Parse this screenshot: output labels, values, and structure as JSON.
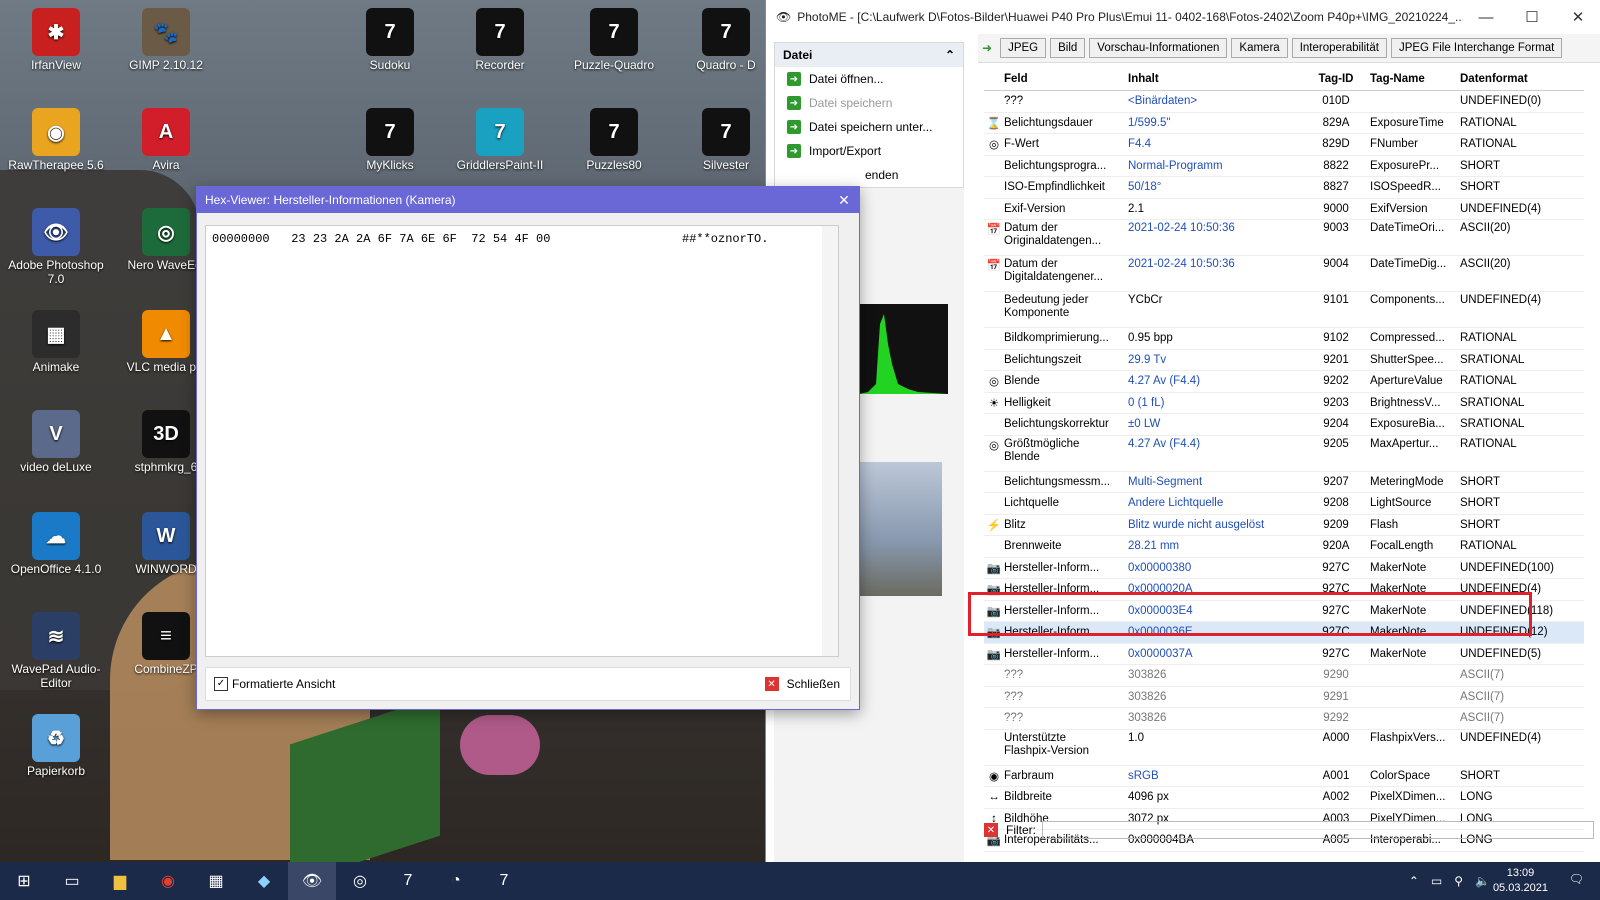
{
  "desktop": {
    "icons": [
      {
        "label": "IrfanView",
        "glyph": "✱",
        "color": "#c8201e"
      },
      {
        "label": "GIMP 2.10.12",
        "glyph": "🐾",
        "color": "#6b5a45"
      },
      {
        "label": "Sudoku",
        "glyph": "7",
        "color": "#111"
      },
      {
        "label": "Recorder",
        "glyph": "7",
        "color": "#111"
      },
      {
        "label": "Puzzle-Quadro",
        "glyph": "7",
        "color": "#111"
      },
      {
        "label": "Quadro - D",
        "glyph": "7",
        "color": "#111"
      },
      {
        "label": "RawTherapee 5.6",
        "glyph": "◉",
        "color": "#e9a520"
      },
      {
        "label": "Avira",
        "glyph": "A",
        "color": "#d21e2b"
      },
      {
        "label": "MyKlicks",
        "glyph": "7",
        "color": "#111"
      },
      {
        "label": "GriddlersPaint-II",
        "glyph": "7",
        "color": "#1aa0c0"
      },
      {
        "label": "Puzzles80",
        "glyph": "7",
        "color": "#111"
      },
      {
        "label": "Silvester",
        "glyph": "7",
        "color": "#111"
      },
      {
        "label": "Adobe Photoshop 7.0",
        "glyph": "👁",
        "color": "#3d5ba8"
      },
      {
        "label": "Nero WaveEdi",
        "glyph": "◎",
        "color": "#1d6b3a"
      },
      {
        "label": "Animake",
        "glyph": "▦",
        "color": "#2c2c2c"
      },
      {
        "label": "VLC media pla",
        "glyph": "▲",
        "color": "#f08a00"
      },
      {
        "label": "video deLuxe",
        "glyph": "V",
        "color": "#5b6a8a"
      },
      {
        "label": "stphmkrg_6",
        "glyph": "3D",
        "color": "#111"
      },
      {
        "label": "OpenOffice 4.1.0",
        "glyph": "☁",
        "color": "#1b7ac7"
      },
      {
        "label": "WINWORD",
        "glyph": "W",
        "color": "#2b579a"
      },
      {
        "label": "WavePad Audio-Editor",
        "glyph": "≋",
        "color": "#2b3e66"
      },
      {
        "label": "CombineZP",
        "glyph": "≡",
        "color": "#111"
      },
      {
        "label": "Papierkorb",
        "glyph": "♻",
        "color": "#5aa0d8"
      }
    ]
  },
  "photome": {
    "title": "PhotoME - [C:\\Laufwerk  D\\Fotos-Bilder\\Huawei P40 Pro Plus\\Emui 11- 0402-168\\Fotos-2402\\Zoom P40p+\\IMG_20210224_...",
    "datei_panel": {
      "header": "Datei",
      "items": [
        {
          "label": "Datei öffnen...",
          "disabled": false
        },
        {
          "label": "Datei speichern",
          "disabled": true
        },
        {
          "label": "Datei speichern unter...",
          "disabled": false
        },
        {
          "label": "Import/Export",
          "disabled": false
        }
      ],
      "partial": "enden"
    },
    "tabs": [
      "JPEG",
      "Bild",
      "Vorschau-Informationen",
      "Kamera",
      "Interoperabilität",
      "JPEG File Interchange Format"
    ],
    "columns": [
      "Feld",
      "Inhalt",
      "Tag-ID",
      "Tag-Name",
      "Datenformat"
    ],
    "rows": [
      {
        "icon": "",
        "feld": "???",
        "inhalt": "<Binärdaten>",
        "tag": "010D",
        "name": "",
        "fmt": "UNDEFINED(0)",
        "link": true
      },
      {
        "icon": "⌛",
        "feld": "Belichtungsdauer",
        "inhalt": "1/599.5\"",
        "tag": "829A",
        "name": "ExposureTime",
        "fmt": "RATIONAL",
        "link": true
      },
      {
        "icon": "◎",
        "feld": "F-Wert",
        "inhalt": "F4.4",
        "tag": "829D",
        "name": "FNumber",
        "fmt": "RATIONAL",
        "link": true
      },
      {
        "icon": "",
        "feld": "Belichtungsprogra...",
        "inhalt": "Normal-Programm",
        "tag": "8822",
        "name": "ExposurePr...",
        "fmt": "SHORT",
        "link": true
      },
      {
        "icon": "",
        "feld": "ISO-Empfindlichkeit",
        "inhalt": "50/18°",
        "tag": "8827",
        "name": "ISOSpeedR...",
        "fmt": "SHORT",
        "link": true
      },
      {
        "icon": "",
        "feld": "Exif-Version",
        "inhalt": "2.1",
        "tag": "9000",
        "name": "ExifVersion",
        "fmt": "UNDEFINED(4)",
        "link": false
      },
      {
        "icon": "📅",
        "feld": "Datum der Originaldatengen...",
        "inhalt": "2021-02-24 10:50:36",
        "tag": "9003",
        "name": "DateTimeOri...",
        "fmt": "ASCII(20)",
        "link": true,
        "tall": true
      },
      {
        "icon": "📅",
        "feld": "Datum der Digitaldatengener...",
        "inhalt": "2021-02-24 10:50:36",
        "tag": "9004",
        "name": "DateTimeDig...",
        "fmt": "ASCII(20)",
        "link": true,
        "tall": true
      },
      {
        "icon": "",
        "feld": "Bedeutung jeder Komponente",
        "inhalt": "YCbCr",
        "tag": "9101",
        "name": "Components...",
        "fmt": "UNDEFINED(4)",
        "link": false,
        "tall": true
      },
      {
        "icon": "",
        "feld": "Bildkomprimierung...",
        "inhalt": "0.95 bpp",
        "tag": "9102",
        "name": "Compressed...",
        "fmt": "RATIONAL",
        "link": false
      },
      {
        "icon": "",
        "feld": "Belichtungszeit",
        "inhalt": "29.9 Tv",
        "tag": "9201",
        "name": "ShutterSpee...",
        "fmt": "SRATIONAL",
        "link": true
      },
      {
        "icon": "◎",
        "feld": "Blende",
        "inhalt": "4.27 Av (F4.4)",
        "tag": "9202",
        "name": "ApertureValue",
        "fmt": "RATIONAL",
        "link": true
      },
      {
        "icon": "☀",
        "feld": "Helligkeit",
        "inhalt": "0 (1 fL)",
        "tag": "9203",
        "name": "BrightnessV...",
        "fmt": "SRATIONAL",
        "link": true
      },
      {
        "icon": "",
        "feld": "Belichtungskorrektur",
        "inhalt": "±0 LW",
        "tag": "9204",
        "name": "ExposureBia...",
        "fmt": "SRATIONAL",
        "link": true
      },
      {
        "icon": "◎",
        "feld": "Größtmögliche Blende",
        "inhalt": "4.27 Av (F4.4)",
        "tag": "9205",
        "name": "MaxApertur...",
        "fmt": "RATIONAL",
        "link": true,
        "tall": true
      },
      {
        "icon": "",
        "feld": "Belichtungsmessm...",
        "inhalt": "Multi-Segment",
        "tag": "9207",
        "name": "MeteringMode",
        "fmt": "SHORT",
        "link": true
      },
      {
        "icon": "",
        "feld": "Lichtquelle",
        "inhalt": "Andere Lichtquelle",
        "tag": "9208",
        "name": "LightSource",
        "fmt": "SHORT",
        "link": true
      },
      {
        "icon": "⚡",
        "feld": "Blitz",
        "inhalt": "Blitz wurde nicht ausgelöst",
        "tag": "9209",
        "name": "Flash",
        "fmt": "SHORT",
        "link": true
      },
      {
        "icon": "",
        "feld": "Brennweite",
        "inhalt": "28.21 mm",
        "tag": "920A",
        "name": "FocalLength",
        "fmt": "RATIONAL",
        "link": true
      },
      {
        "icon": "📷",
        "feld": "Hersteller-Inform...",
        "inhalt": "0x00000380",
        "tag": "927C",
        "name": "MakerNote",
        "fmt": "UNDEFINED(100)",
        "link": true
      },
      {
        "icon": "📷",
        "feld": "Hersteller-Inform...",
        "inhalt": "0x0000020A",
        "tag": "927C",
        "name": "MakerNote",
        "fmt": "UNDEFINED(4)",
        "link": true
      },
      {
        "icon": "📷",
        "feld": "Hersteller-Inform...",
        "inhalt": "0x000003E4",
        "tag": "927C",
        "name": "MakerNote",
        "fmt": "UNDEFINED(118)",
        "link": true
      },
      {
        "icon": "📷",
        "feld": "Hersteller-Inform...",
        "inhalt": "0x0000036E",
        "tag": "927C",
        "name": "MakerNote",
        "fmt": "UNDEFINED(12)",
        "link": true,
        "selected": true
      },
      {
        "icon": "📷",
        "feld": "Hersteller-Inform...",
        "inhalt": "0x0000037A",
        "tag": "927C",
        "name": "MakerNote",
        "fmt": "UNDEFINED(5)",
        "link": true
      },
      {
        "icon": "",
        "feld": "???",
        "inhalt": "303826",
        "tag": "9290",
        "name": "",
        "fmt": "ASCII(7)",
        "grey": true
      },
      {
        "icon": "",
        "feld": "???",
        "inhalt": "303826",
        "tag": "9291",
        "name": "",
        "fmt": "ASCII(7)",
        "grey": true
      },
      {
        "icon": "",
        "feld": "???",
        "inhalt": "303826",
        "tag": "9292",
        "name": "",
        "fmt": "ASCII(7)",
        "grey": true
      },
      {
        "icon": "",
        "feld": "Unterstützte Flashpix-Version",
        "inhalt": "1.0",
        "tag": "A000",
        "name": "FlashpixVers...",
        "fmt": "UNDEFINED(4)",
        "link": false,
        "tall": true
      },
      {
        "icon": "◉",
        "feld": "Farbraum",
        "inhalt": "sRGB",
        "tag": "A001",
        "name": "ColorSpace",
        "fmt": "SHORT",
        "link": true
      },
      {
        "icon": "↔",
        "feld": "Bildbreite",
        "inhalt": "4096 px",
        "tag": "A002",
        "name": "PixelXDimen...",
        "fmt": "LONG",
        "link": false
      },
      {
        "icon": "↕",
        "feld": "Bildhöhe",
        "inhalt": "3072 px",
        "tag": "A003",
        "name": "PixelYDimen...",
        "fmt": "LONG",
        "link": false
      },
      {
        "icon": "📷",
        "feld": "Interoperabilitäts...",
        "inhalt": "0x000004BA",
        "tag": "A005",
        "name": "Interoperabi...",
        "fmt": "LONG",
        "link": false
      }
    ],
    "filter_label": "Filter:"
  },
  "hex_viewer": {
    "title": "Hex-Viewer: Hersteller-Informationen (Kamera)",
    "offset": "00000000",
    "bytes": "23 23 2A 2A 6F 7A 6E 6F  72 54 4F 00",
    "ascii": "##**oznorTO.",
    "formatted_label": "Formatierte Ansicht",
    "close_label": "Schließen"
  },
  "taskbar": {
    "time": "13:09",
    "date": "05.03.2021"
  }
}
